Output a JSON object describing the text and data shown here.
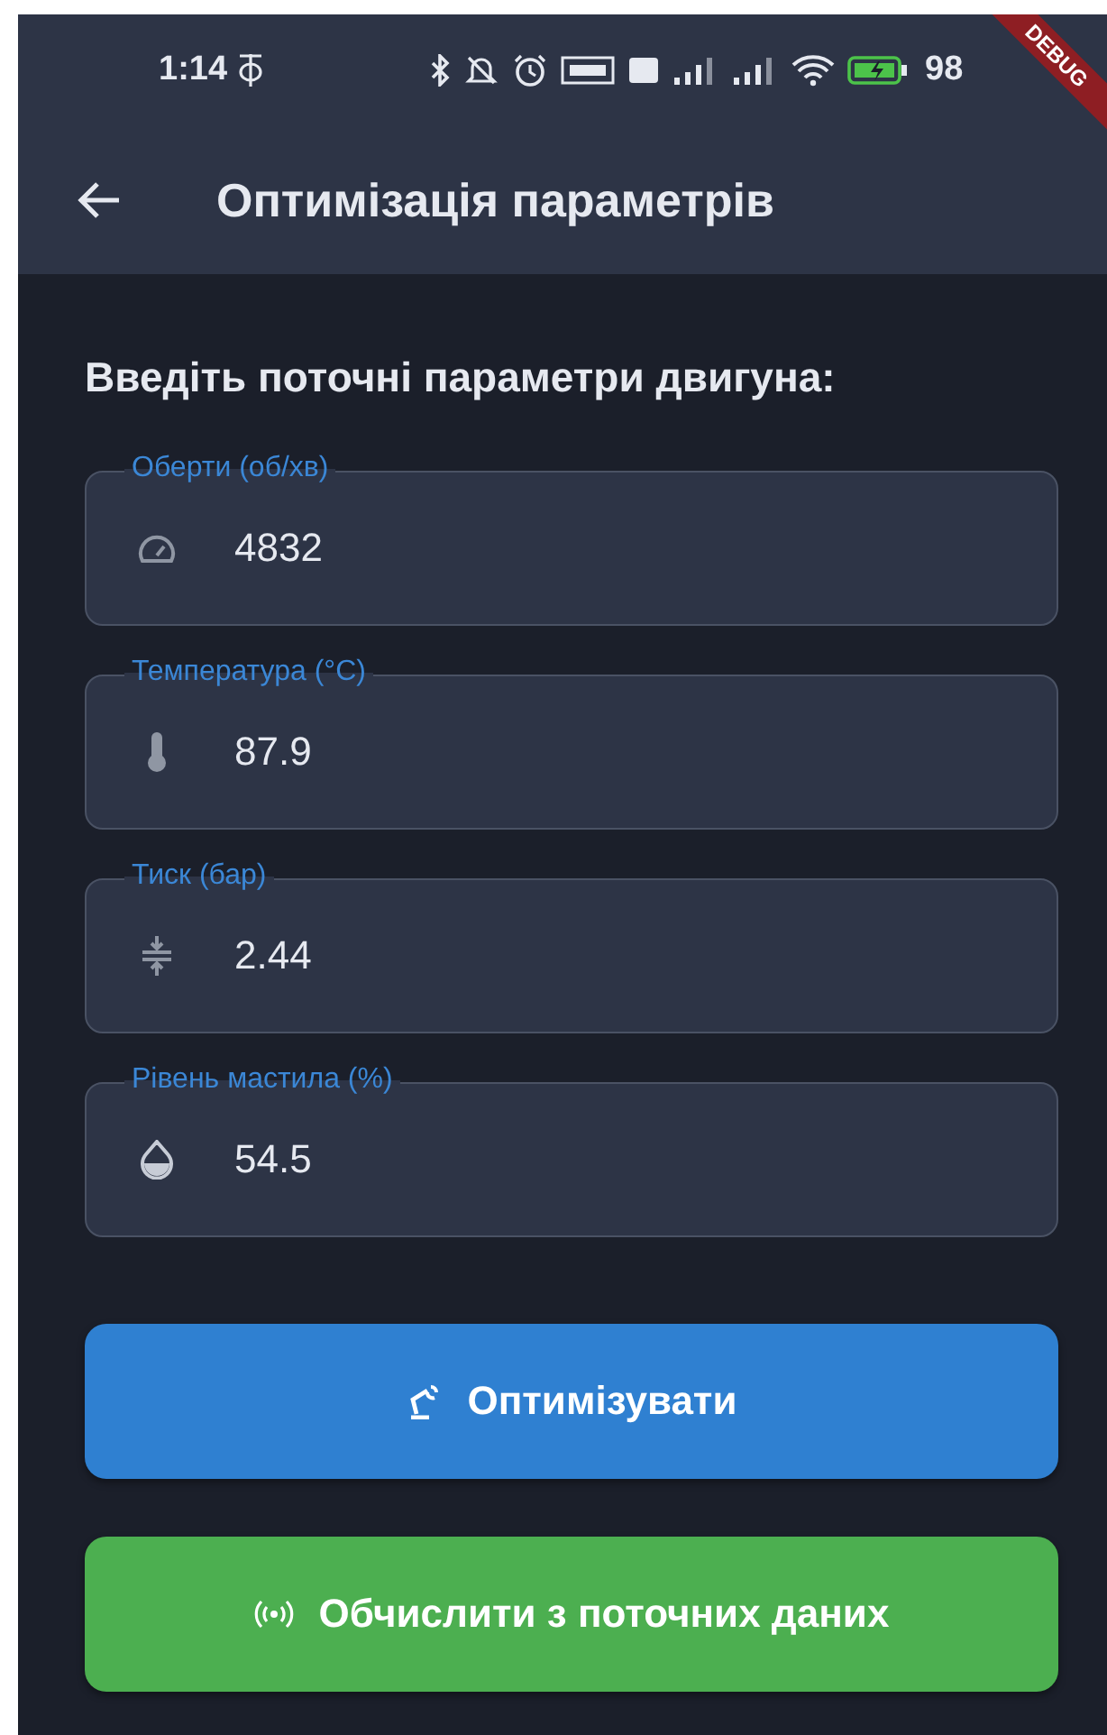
{
  "status_bar": {
    "time": "1:14",
    "battery": "98"
  },
  "debug_banner": "DEBUG",
  "app_bar": {
    "title": "Оптимізація параметрів"
  },
  "heading": "Введіть поточні параметри двигуна:",
  "fields": [
    {
      "kind": "speed",
      "label": "Оберти (об/хв)",
      "value": "4832"
    },
    {
      "kind": "temperature",
      "label": "Температура (°C)",
      "value": "87.9"
    },
    {
      "kind": "pressure",
      "label": "Тиск (бар)",
      "value": "2.44"
    },
    {
      "kind": "oil",
      "label": "Рівень мастила (%)",
      "value": "54.5"
    }
  ],
  "buttons": [
    {
      "kind": "optimize",
      "label": "Оптимізувати",
      "color": "#2f80d1"
    },
    {
      "kind": "sensor",
      "label": "Обчислити з поточних даних",
      "color": "#4caf50"
    }
  ]
}
